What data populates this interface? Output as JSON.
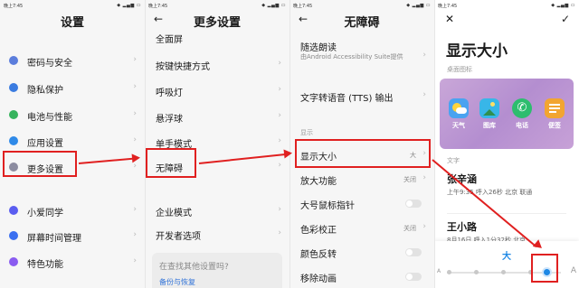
{
  "status": {
    "time": "晚上7:45",
    "icons": "◆ ▂▄▆ ▭"
  },
  "colors": {
    "highlight": "#e02020",
    "accent": "#1e88e5"
  },
  "panel1": {
    "title": "设置",
    "items": [
      {
        "label": "密码与安全",
        "icon": "lock-icon",
        "color": "#5b7ddc"
      },
      {
        "label": "隐私保护",
        "icon": "shield-icon",
        "color": "#3a7be0"
      },
      {
        "label": "电池与性能",
        "icon": "battery-icon",
        "color": "#36b35d"
      },
      {
        "label": "应用设置",
        "icon": "gear-icon",
        "color": "#2f8ae8"
      },
      {
        "label": "更多设置",
        "icon": "dots-icon",
        "color": "#8c8ca0"
      },
      {
        "label": "小爱同学",
        "icon": "assistant-icon",
        "color": "#5a5df0"
      },
      {
        "label": "屏幕时间管理",
        "icon": "hourglass-icon",
        "color": "#3a6ff0"
      },
      {
        "label": "特色功能",
        "icon": "star-icon",
        "color": "#8a5cf0"
      }
    ]
  },
  "panel2": {
    "title": "更多设置",
    "items": [
      {
        "label": "全面屏"
      },
      {
        "label": "按键快捷方式"
      },
      {
        "label": "呼吸灯"
      },
      {
        "label": "悬浮球"
      },
      {
        "label": "单手模式"
      },
      {
        "label": "无障碍"
      },
      {
        "label": "企业模式"
      },
      {
        "label": "开发者选项"
      }
    ],
    "search_prompt": "在查找其他设置吗?",
    "backup_link": "备份与恢复"
  },
  "panel3": {
    "title": "无障碍",
    "select_to_speak": "随选朗读",
    "select_to_speak_sub": "由Android Accessibility Suite提供",
    "tts": "文字转语音 (TTS) 输出",
    "section": "显示",
    "items": [
      {
        "label": "显示大小",
        "value": "大",
        "type": "chevron"
      },
      {
        "label": "放大功能",
        "value": "关闭",
        "type": "chevron"
      },
      {
        "label": "大号鼠标指针",
        "value": "",
        "type": "toggle"
      },
      {
        "label": "色彩校正",
        "value": "关闭",
        "type": "chevron"
      },
      {
        "label": "颜色反转",
        "value": "",
        "type": "toggle"
      },
      {
        "label": "移除动画",
        "value": "",
        "type": "toggle"
      }
    ]
  },
  "panel4": {
    "title": "显示大小",
    "desktop_icons": "桌面图标",
    "apps": [
      {
        "label": "天气",
        "icon": "weather-icon",
        "color": "#4aa3f0"
      },
      {
        "label": "图库",
        "icon": "gallery-icon",
        "color": "#38b6e8"
      },
      {
        "label": "电话",
        "icon": "phone-icon",
        "color": "#2dbd6e"
      },
      {
        "label": "便签",
        "icon": "notes-icon",
        "color": "#f2a531"
      }
    ],
    "text_section": "文字",
    "messages": [
      {
        "name": "张辛涵",
        "sub": "上午9:35 呼入26秒 北京 联通"
      },
      {
        "name": "王小路",
        "sub": "8月16日 呼入1分32秒 北京"
      }
    ],
    "size_label": "大",
    "size_level": 0.88
  }
}
